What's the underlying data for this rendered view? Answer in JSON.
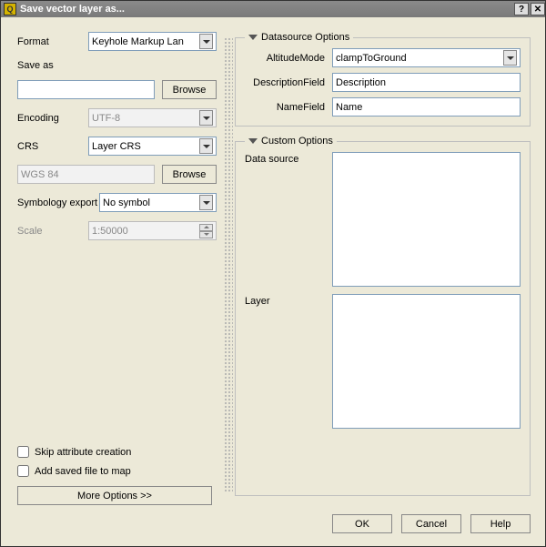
{
  "title": "Save vector layer as...",
  "left": {
    "format_label": "Format",
    "format_value": "Keyhole Markup Lan",
    "saveas_label": "Save as",
    "saveas_value": "",
    "browse1": "Browse",
    "encoding_label": "Encoding",
    "encoding_value": "UTF-8",
    "crs_label": "CRS",
    "crs_value": "Layer CRS",
    "crs_text_value": "WGS 84",
    "browse2": "Browse",
    "symbology_label": "Symbology export",
    "symbology_value": "No symbol",
    "scale_label": "Scale",
    "scale_value": "1:50000",
    "skip_attr_label": "Skip attribute creation",
    "add_saved_label": "Add saved file to map",
    "more_options": "More Options >>"
  },
  "right": {
    "datasource_legend": "Datasource Options",
    "altitude_label": "AltitudeMode",
    "altitude_value": "clampToGround",
    "descfield_label": "DescriptionField",
    "descfield_value": "Description",
    "namefield_label": "NameField",
    "namefield_value": "Name",
    "custom_legend": "Custom Options",
    "datasource_label": "Data source",
    "layer_label": "Layer"
  },
  "footer": {
    "ok": "OK",
    "cancel": "Cancel",
    "help": "Help"
  }
}
